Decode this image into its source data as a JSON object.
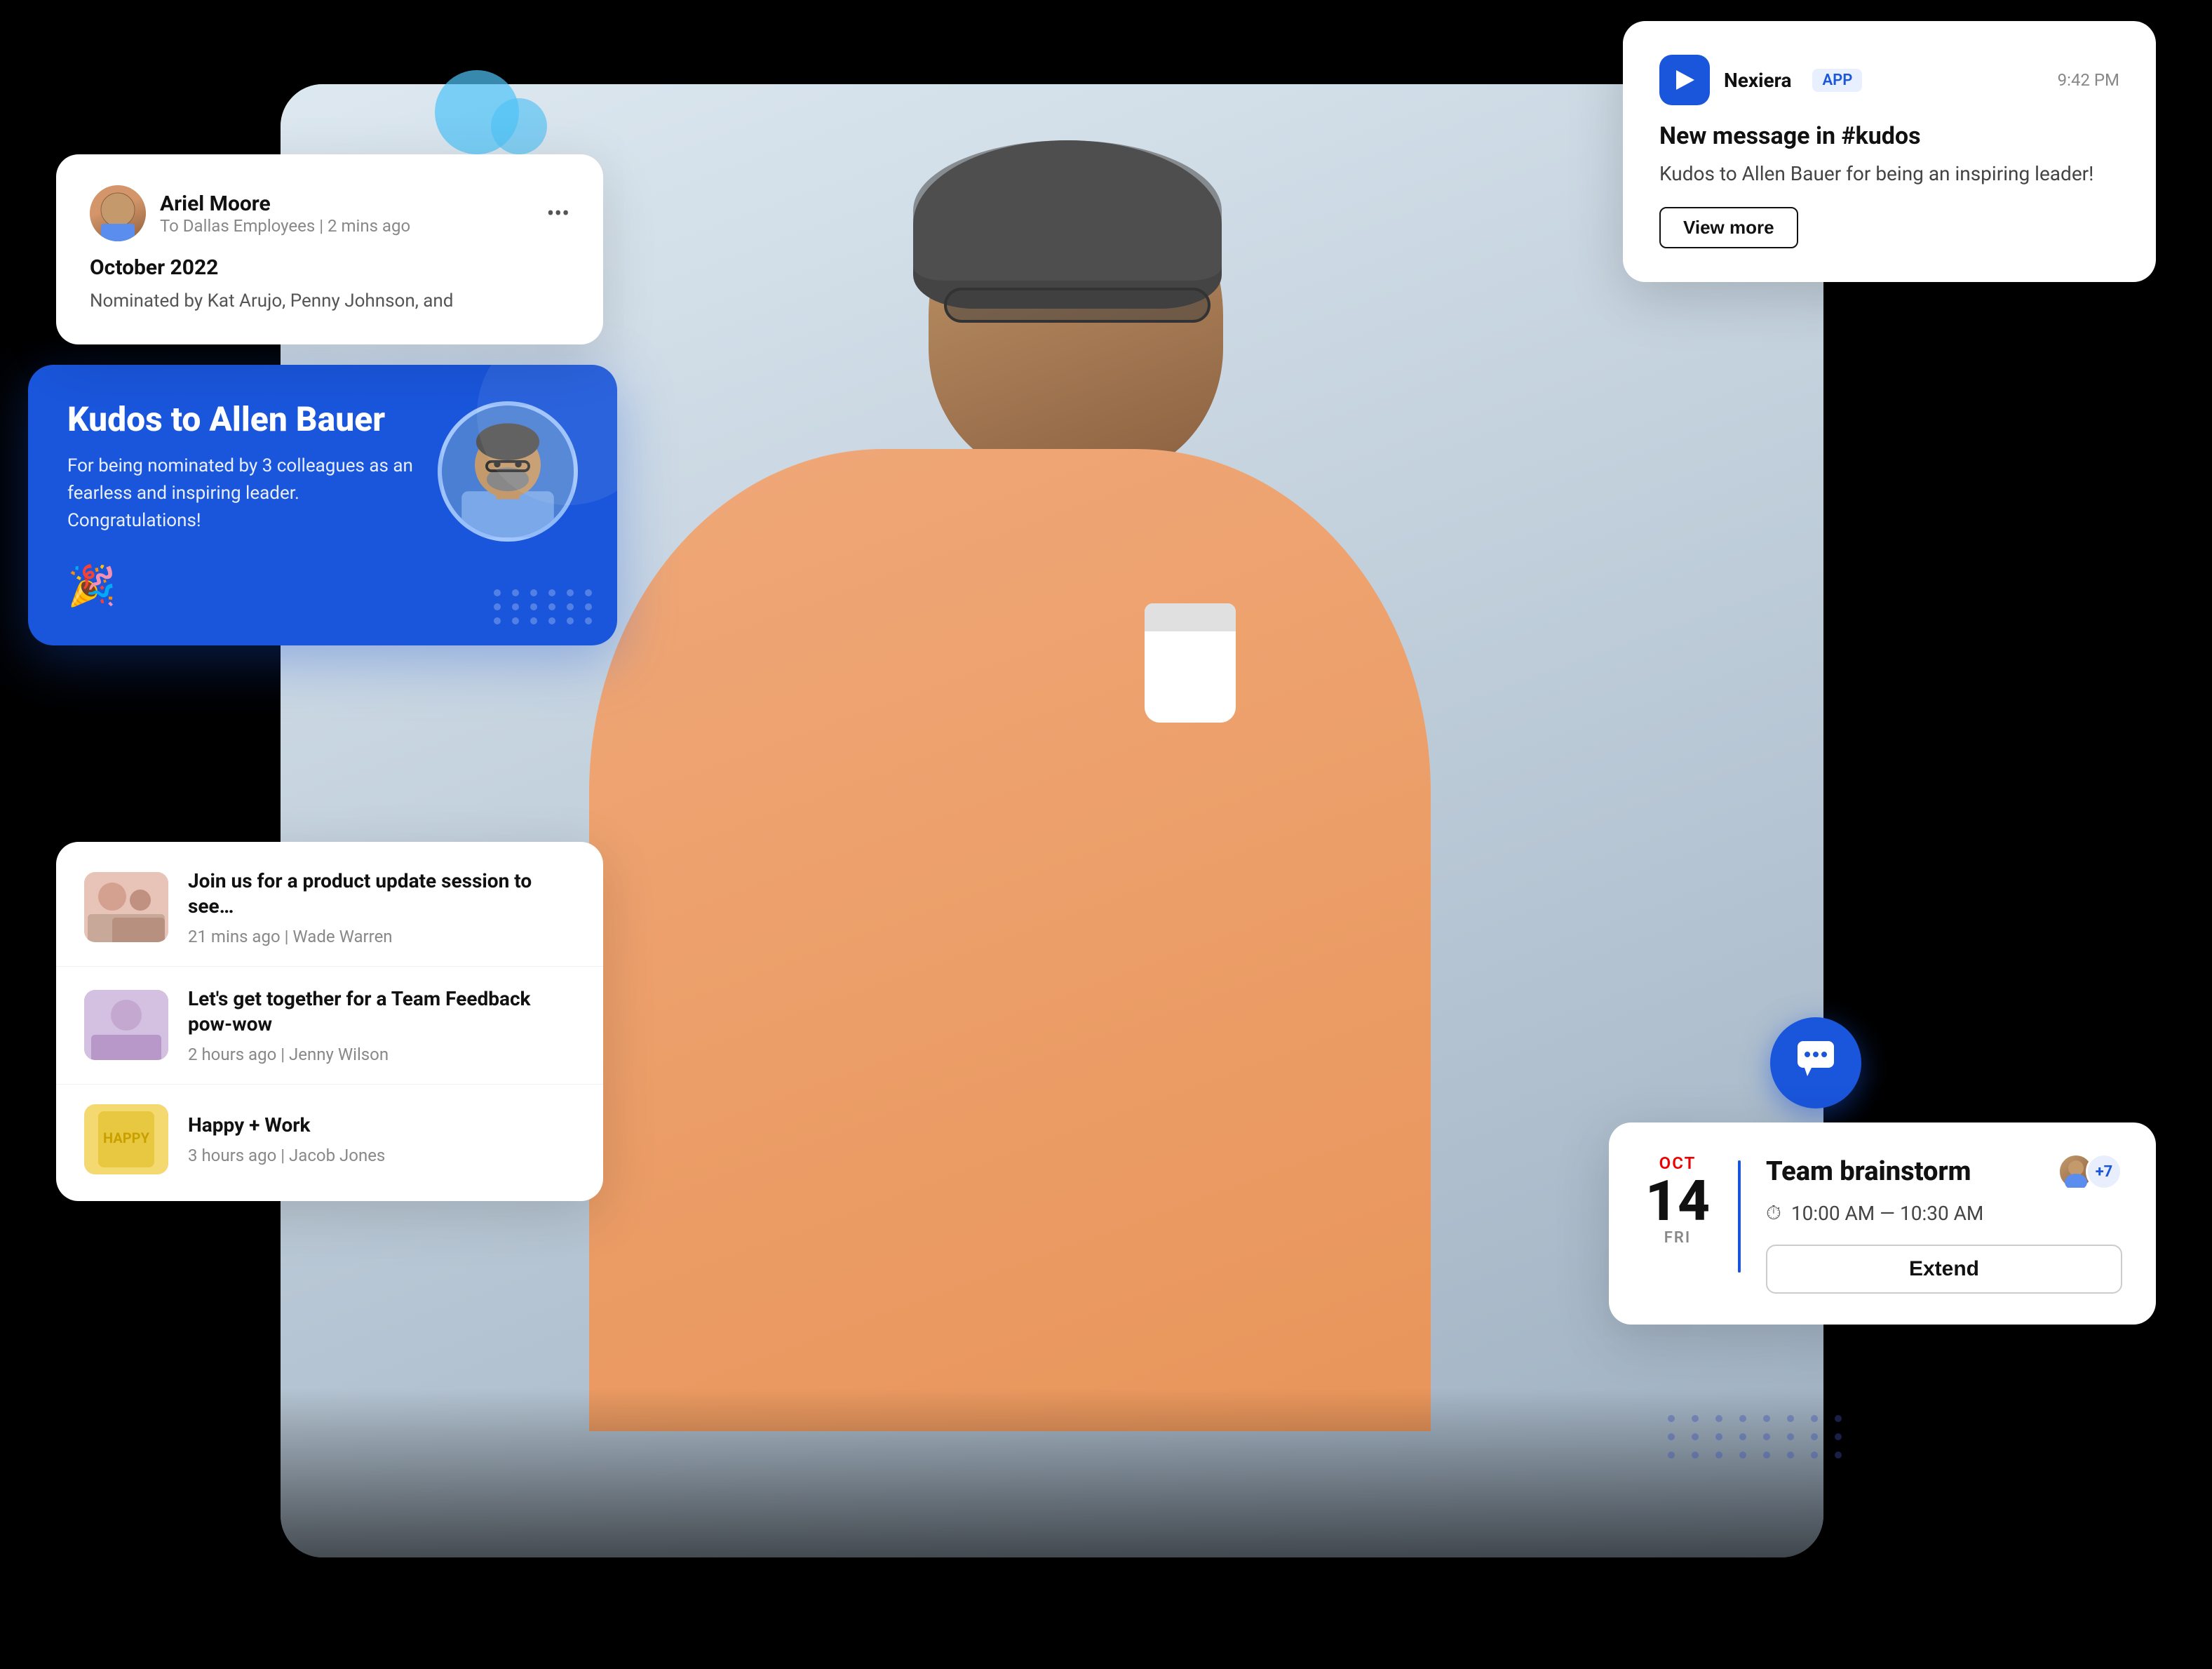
{
  "notification": {
    "app_name": "Nexiera",
    "app_badge": "APP",
    "time": "9:42 PM",
    "title": "New message in #kudos",
    "body": "Kudos to Allen Bauer for being an inspiring leader!",
    "button_label": "View more",
    "icon_symbol": "▶"
  },
  "post": {
    "author": "Ariel Moore",
    "recipient": "To Dallas Employees",
    "time_ago": "2 mins ago",
    "title": "October 2022",
    "content": "Nominated by Kat Arujo, Penny Johnson, and",
    "more_icon": "•••"
  },
  "kudos": {
    "title": "Kudos to Allen Bauer",
    "subtitle": "For being nominated by 3 colleagues as an fearless and inspiring leader. Congratulations!",
    "party_icon": "🎉"
  },
  "news_feed": {
    "items": [
      {
        "title": "Join us for a product update session to see…",
        "time_ago": "21 mins ago",
        "author": "Wade Warren",
        "thumb_color": "#e8c4b8"
      },
      {
        "title": "Let's get together for a Team Feedback pow-wow",
        "time_ago": "2 hours ago",
        "author": "Jenny Wilson",
        "thumb_color": "#c8b8e0"
      },
      {
        "title": "Happy + Work",
        "time_ago": "3 hours ago",
        "author": "Jacob Jones",
        "thumb_color": "#f4d070"
      }
    ]
  },
  "meeting": {
    "month": "OCT",
    "day": "14",
    "weekday": "FRI",
    "title": "Team brainstorm",
    "time_range": "10:00 AM — 10:30 AM",
    "attendee_count": "+7",
    "extend_label": "Extend"
  },
  "chat_fab": {
    "icon": "💬"
  }
}
